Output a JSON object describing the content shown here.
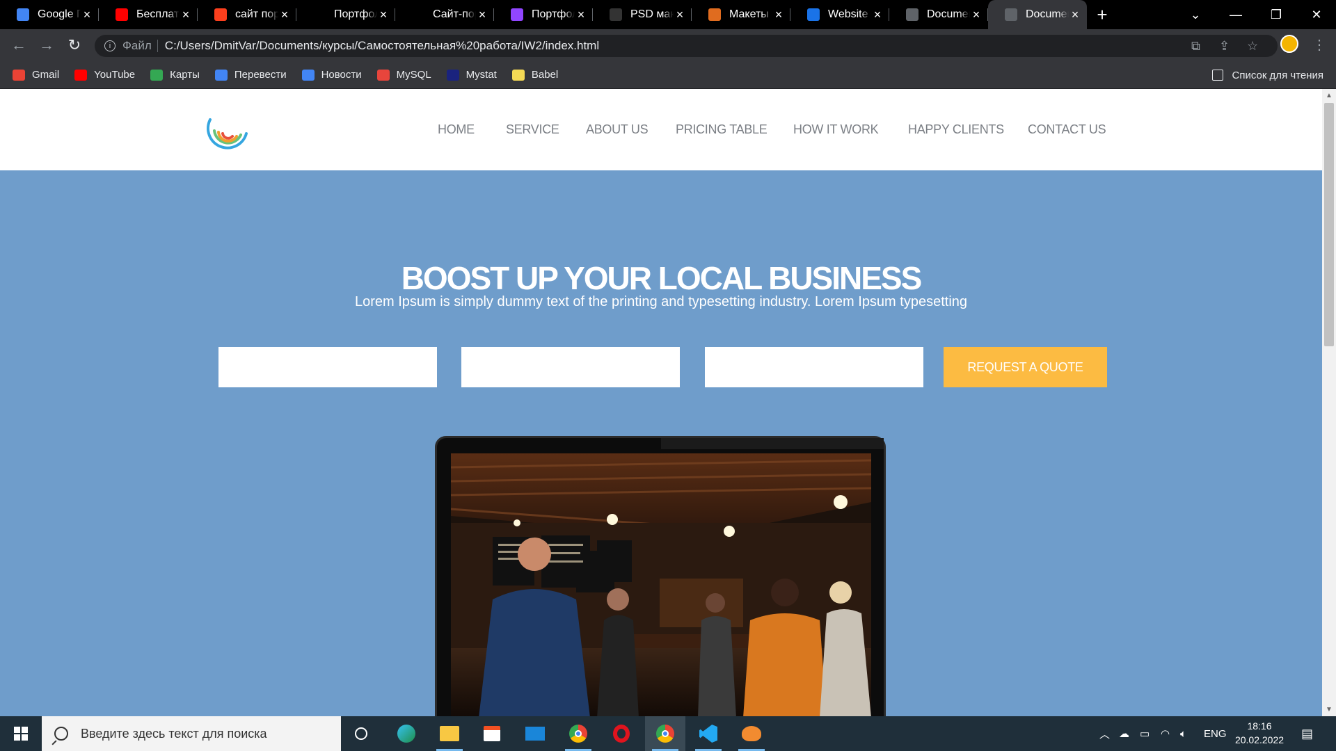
{
  "browser": {
    "tabs": [
      {
        "title": "Google Переводчик",
        "icon": "google-translate-icon",
        "color": "#4285f4"
      },
      {
        "title": "Бесплатные",
        "icon": "youtube-icon",
        "color": "#ff0000"
      },
      {
        "title": "сайт портфолио",
        "icon": "yandex-icon",
        "color": "#fc3f1d"
      },
      {
        "title": "Портфолио",
        "icon": "blank-icon",
        "color": "#000000"
      },
      {
        "title": "Сайт-портфолио",
        "icon": "tb-icon",
        "color": "#000000"
      },
      {
        "title": "Портфолио",
        "icon": "twitch-icon",
        "color": "#9146ff"
      },
      {
        "title": "PSD макеты",
        "icon": "psd-icon",
        "color": "#333333"
      },
      {
        "title": "Макеты с",
        "icon": "w-icon",
        "color": "#e06c1f"
      },
      {
        "title": "Website Portfolio",
        "icon": "website-icon",
        "color": "#1a73e8"
      },
      {
        "title": "Document",
        "icon": "globe-icon",
        "color": "#5f6368"
      },
      {
        "title": "Document",
        "icon": "globe-icon",
        "color": "#5f6368",
        "active": true
      }
    ],
    "new_tab": "+",
    "address": {
      "scheme": "Файл",
      "url": "C:/Users/DmitVar/Documents/курсы/Самостоятельная%20работа/IW2/index.html"
    },
    "bookmarks": [
      {
        "label": "Gmail",
        "icon": "gmail-icon",
        "color": "#ea4335"
      },
      {
        "label": "YouTube",
        "icon": "youtube-icon",
        "color": "#ff0000"
      },
      {
        "label": "Карты",
        "icon": "maps-icon",
        "color": "#34a853"
      },
      {
        "label": "Перевести",
        "icon": "translate-icon",
        "color": "#4285f4"
      },
      {
        "label": "Новости",
        "icon": "news-icon",
        "color": "#4285f4"
      },
      {
        "label": "MySQL",
        "icon": "code-icon",
        "color": "#e8453c"
      },
      {
        "label": "Mystat",
        "icon": "mystat-icon",
        "color": "#1a237e"
      },
      {
        "label": "Babel",
        "icon": "babel-icon",
        "color": "#f5da55"
      }
    ],
    "reading_list": "Список для чтения"
  },
  "page": {
    "nav": [
      "HOME",
      "SERVICE",
      "ABOUT US",
      "PRICING TABLE",
      "HOW IT WORK",
      "HAPPY CLIENTS",
      "CONTACT US"
    ],
    "hero": {
      "title": "BOOST UP YOUR LOCAL BUSINESS",
      "subtitle": "Lorem Ipsum is simply dummy text of the printing and typesetting industry. Lorem Ipsum typesetting",
      "field1": "",
      "field2": "",
      "field3": "",
      "cta": "REQUEST A QUOTE"
    },
    "colors": {
      "hero_bg": "#6f9dcb",
      "cta": "#fcbb42",
      "nav_text": "#7b7f85"
    }
  },
  "taskbar": {
    "search_placeholder": "Введите здесь текст для поиска",
    "apps": [
      "task-view-icon",
      "edge-icon",
      "file-explorer-icon",
      "store-icon",
      "mail-icon",
      "chrome-icon",
      "opera-icon",
      "chrome-icon",
      "vscode-icon",
      "app-icon"
    ],
    "language": "ENG",
    "time": "18:16",
    "date": "20.02.2022"
  }
}
